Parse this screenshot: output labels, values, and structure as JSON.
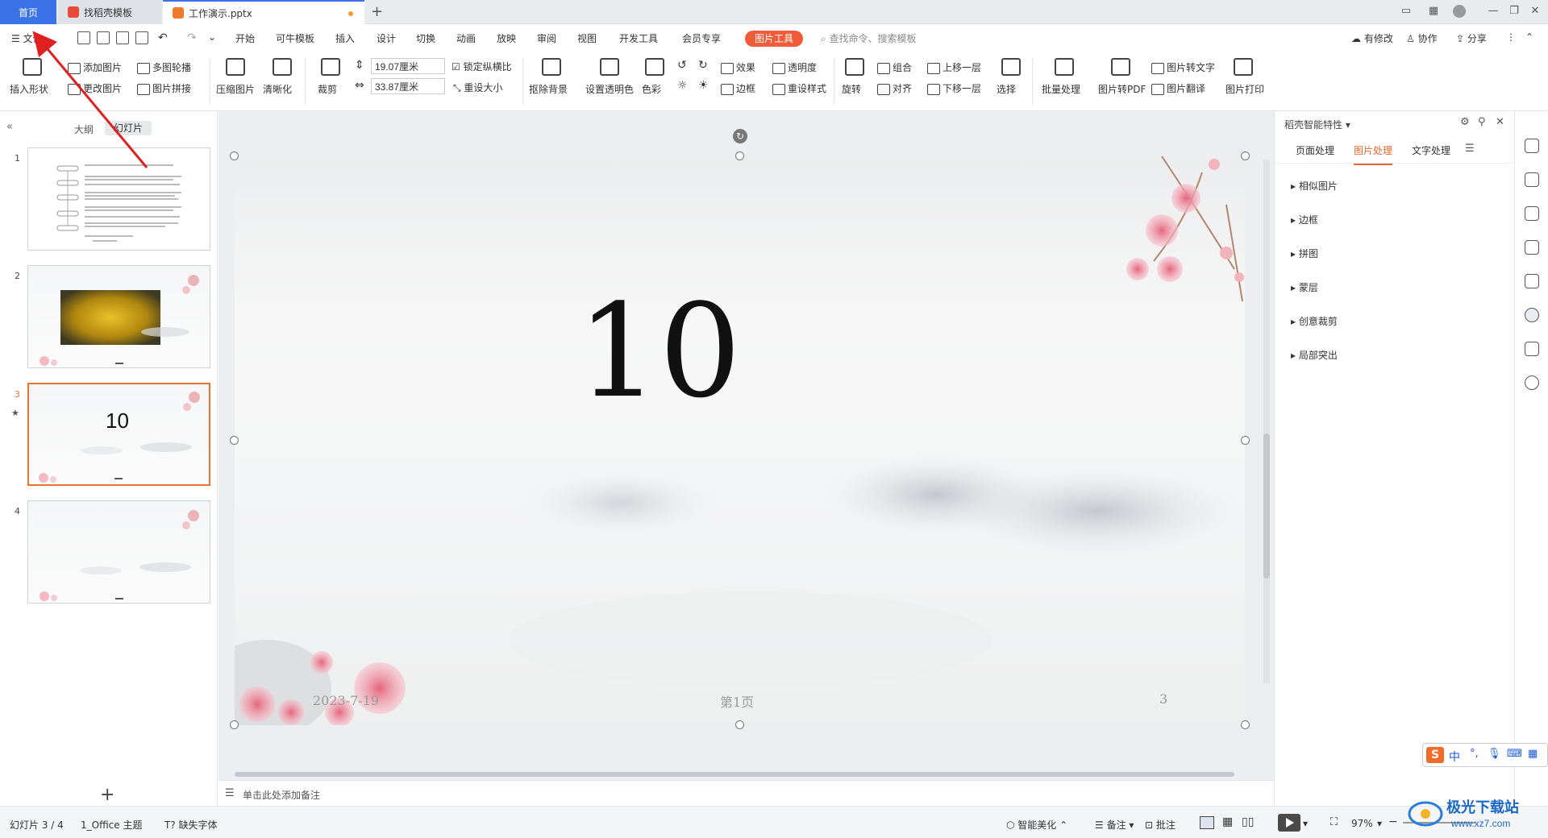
{
  "tabs": {
    "home": "首页",
    "template": "找稻壳模板",
    "document": "工作演示.pptx"
  },
  "menu": {
    "file": "文件",
    "items": [
      "开始",
      "可牛模板",
      "插入",
      "设计",
      "切换",
      "动画",
      "放映",
      "审阅",
      "视图",
      "开发工具",
      "会员专享"
    ],
    "picture_tools": "图片工具",
    "search_placeholder": "查找命令、搜索模板",
    "right": {
      "changes": "有修改",
      "collab": "协作",
      "share": "分享"
    }
  },
  "ribbon": {
    "insert_shape": "插入形状",
    "add_image": "添加图片",
    "multi_carousel": "多图轮播",
    "change_image": "更改图片",
    "image_collage": "图片拼接",
    "compress": "压缩图片",
    "sharpen": "清晰化",
    "crop": "裁剪",
    "width": "19.07厘米",
    "height": "33.87厘米",
    "lock_ratio": "锁定纵横比",
    "reset_size": "重设大小",
    "remove_bg": "抠除背景",
    "set_transparent": "设置透明色",
    "color": "色彩",
    "effects": "效果",
    "transparency": "透明度",
    "border": "边框",
    "reset_style": "重设样式",
    "group": "组合",
    "bring_forward": "上移一层",
    "rotate": "旋转",
    "align": "对齐",
    "send_backward": "下移一层",
    "select": "选择",
    "batch": "批量处理",
    "to_pdf": "图片转PDF",
    "to_text": "图片转文字",
    "translate": "图片翻译",
    "print": "图片打印"
  },
  "left_panel": {
    "outline": "大纲",
    "slides": "幻灯片",
    "slide_numbers": [
      "1",
      "2",
      "3",
      "4"
    ],
    "thumb3_number": "10"
  },
  "slide": {
    "main_number": "10",
    "date": "2023-7-19",
    "page_label": "第1页",
    "page_number": "3"
  },
  "notes_placeholder": "单击此处添加备注",
  "right_panel": {
    "title": "稻壳智能特性",
    "tabs": [
      "页面处理",
      "图片处理",
      "文字处理"
    ],
    "active_tab": "图片处理",
    "items": [
      "相似图片",
      "边框",
      "拼图",
      "蒙层",
      "创意裁剪",
      "局部突出"
    ]
  },
  "status": {
    "slide_counter": "幻灯片 3 / 4",
    "theme": "1_Office 主题",
    "missing_font": "缺失字体",
    "smart_beautify": "智能美化",
    "notes": "备注",
    "comments": "批注",
    "zoom": "97%"
  },
  "ime": {
    "lang": "中"
  },
  "watermark": {
    "site": "极光下载站",
    "url": "www.xz7.com"
  },
  "colors": {
    "accent": "#e8662c",
    "picture_tools_bg": "#f05c3a",
    "home_tab": "#3a73e8",
    "arrow": "#e02020"
  }
}
